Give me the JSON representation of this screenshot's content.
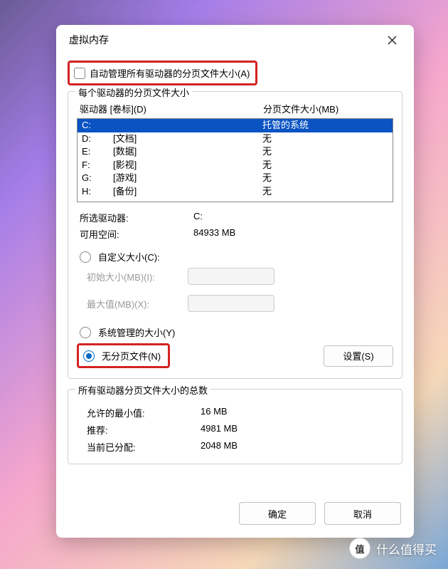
{
  "dialog": {
    "title": "虚拟内存",
    "auto_manage_label": "自动管理所有驱动器的分页文件大小(A)"
  },
  "drives_group": {
    "title": "每个驱动器的分页文件大小",
    "header_drive": "驱动器 [卷标](D)",
    "header_size": "分页文件大小(MB)",
    "list": [
      {
        "letter": "C:",
        "label": "",
        "pf": "托管的系统",
        "selected": true
      },
      {
        "letter": "D:",
        "label": "[文档]",
        "pf": "无",
        "selected": false
      },
      {
        "letter": "E:",
        "label": "[数据]",
        "pf": "无",
        "selected": false
      },
      {
        "letter": "F:",
        "label": "[影视]",
        "pf": "无",
        "selected": false
      },
      {
        "letter": "G:",
        "label": "[游戏]",
        "pf": "无",
        "selected": false
      },
      {
        "letter": "H:",
        "label": "[备份]",
        "pf": "无",
        "selected": false
      }
    ],
    "selected_drive_label": "所选驱动器:",
    "selected_drive_value": "C:",
    "available_space_label": "可用空间:",
    "available_space_value": "84933 MB",
    "custom_size_label": "自定义大小(C):",
    "initial_size_label": "初始大小(MB)(I):",
    "max_size_label": "最大值(MB)(X):",
    "system_managed_label": "系统管理的大小(Y)",
    "no_paging_file_label": "无分页文件(N)",
    "set_button": "设置(S)"
  },
  "totals_group": {
    "title": "所有驱动器分页文件大小的总数",
    "min_allowed_label": "允许的最小值:",
    "min_allowed_value": "16 MB",
    "recommended_label": "推荐:",
    "recommended_value": "4981 MB",
    "currently_allocated_label": "当前已分配:",
    "currently_allocated_value": "2048 MB"
  },
  "footer": {
    "ok": "确定",
    "cancel": "取消"
  },
  "watermark": {
    "badge": "值",
    "text": "什么值得买"
  }
}
